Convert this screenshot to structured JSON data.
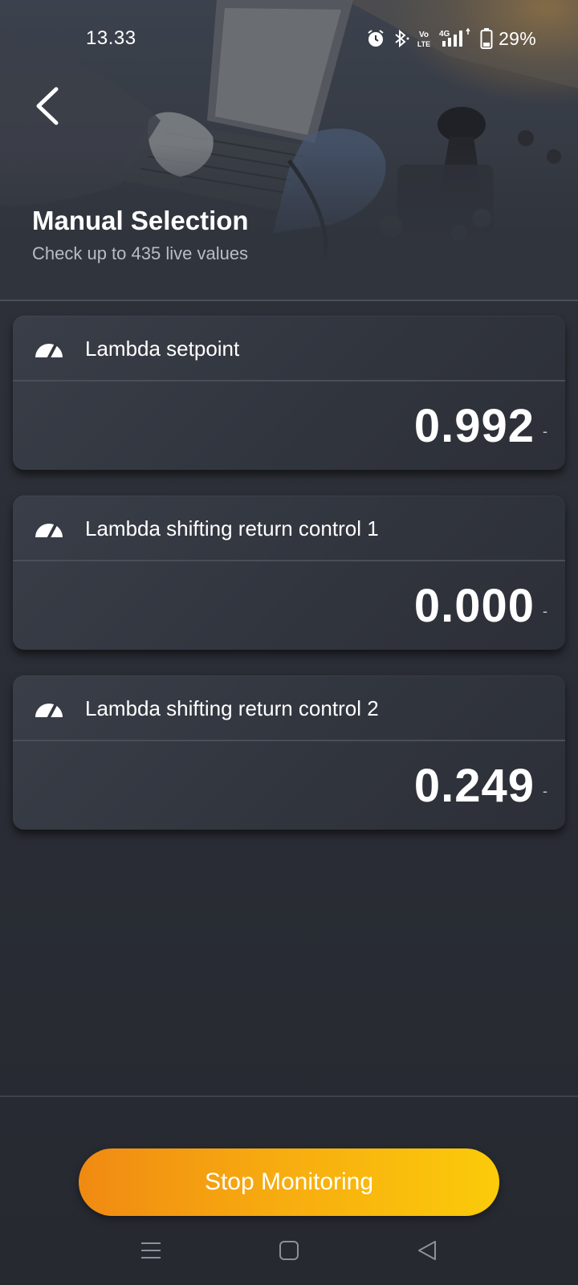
{
  "status_bar": {
    "time": "13.33",
    "network_label": "4G",
    "volte_label": "Vo LTE",
    "battery": "29%"
  },
  "header": {
    "title": "Manual Selection",
    "subtitle": "Check up to 435 live values"
  },
  "cards": [
    {
      "label": "Lambda setpoint",
      "value": "0.992",
      "unit": "-",
      "icon": "gauge-icon"
    },
    {
      "label": "Lambda shifting return control 1",
      "value": "0.000",
      "unit": "-",
      "icon": "gauge-icon"
    },
    {
      "label": "Lambda shifting return control 2",
      "value": "0.249",
      "unit": "-",
      "icon": "gauge-icon"
    }
  ],
  "footer": {
    "button_label": "Stop Monitoring"
  },
  "colors": {
    "accent_start": "#f08a12",
    "accent_end": "#fbcb0a",
    "background": "#2b2e36",
    "card": "#353943"
  }
}
